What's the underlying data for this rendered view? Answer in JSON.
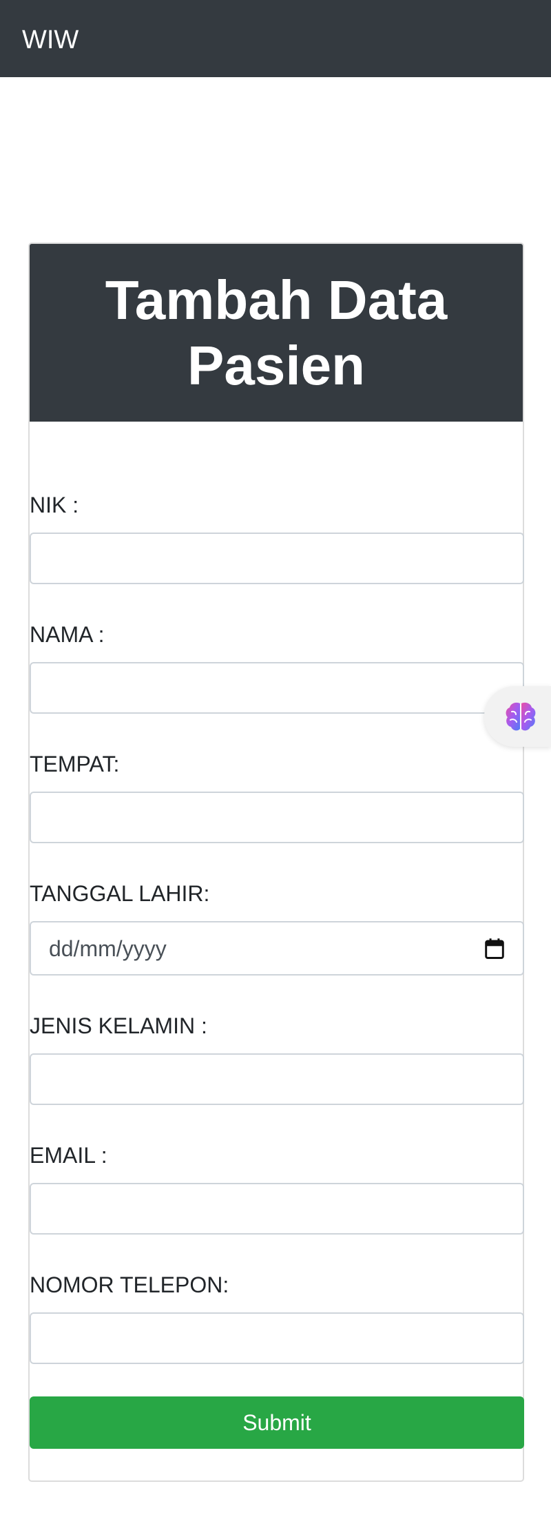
{
  "navbar": {
    "brand": "WIW"
  },
  "form": {
    "title": "Tambah Data Pasien",
    "fields": [
      {
        "label": "NIK :",
        "value": ""
      },
      {
        "label": "NAMA :",
        "value": ""
      },
      {
        "label": "TEMPAT:",
        "value": ""
      },
      {
        "label": "TANGGAL LAHIR:",
        "placeholder": "dd/mm/yyyy"
      },
      {
        "label": "JENIS KELAMIN :",
        "value": ""
      },
      {
        "label": "EMAIL :",
        "value": ""
      },
      {
        "label": "NOMOR TELEPON:",
        "value": ""
      }
    ],
    "submit_label": "Submit"
  },
  "icons": {
    "date_picker": "calendar-icon",
    "floating_widget": "brain-icon"
  },
  "colors": {
    "navbar_bg": "#343a40",
    "header_bg": "#343a40",
    "submit_bg": "#28a745",
    "input_border": "#ced4da"
  }
}
